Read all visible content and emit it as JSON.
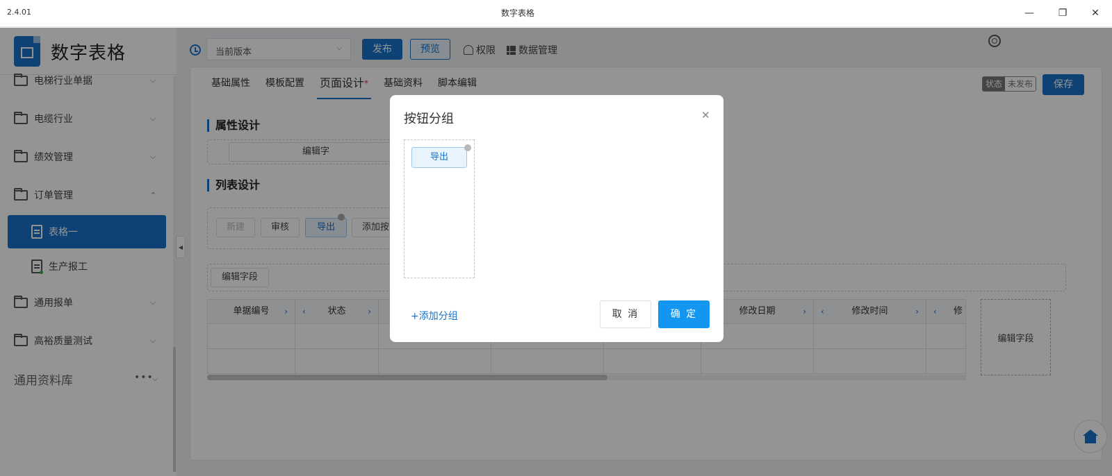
{
  "window": {
    "version": "2.4.01",
    "title": "数字表格",
    "controls": [
      "minimize-icon",
      "restore-icon",
      "close-icon"
    ]
  },
  "brand": {
    "name": "数字表格"
  },
  "sidebar": {
    "items": [
      {
        "label": "电梯行业单据",
        "icon": "folder-icon",
        "expanded": false
      },
      {
        "label": "电缆行业",
        "icon": "folder-icon",
        "expanded": false
      },
      {
        "label": "绩效管理",
        "icon": "folder-icon",
        "expanded": false
      },
      {
        "label": "订单管理",
        "icon": "folder-icon",
        "expanded": true
      }
    ],
    "sub_items": [
      {
        "label": "表格一",
        "icon": "document-icon",
        "active": true
      },
      {
        "label": "生产报工",
        "icon": "document-icon",
        "active": false
      }
    ],
    "items_after": [
      {
        "label": "通用报单",
        "icon": "folder-icon"
      },
      {
        "label": "高裕质量测试",
        "icon": "folder-icon"
      }
    ],
    "library": {
      "label": "通用资料库",
      "more": "•••"
    }
  },
  "toolbar": {
    "version_select": "当前版本",
    "publish": "发布",
    "preview": "预览",
    "permission": "权限",
    "data_manage": "数据管理"
  },
  "tabs": [
    {
      "label": "基础属性",
      "active": false
    },
    {
      "label": "模板配置",
      "active": false
    },
    {
      "label": "页面设计",
      "active": true,
      "modified": "*"
    },
    {
      "label": "基础资料",
      "active": false
    },
    {
      "label": "脚本编辑",
      "active": false
    }
  ],
  "status": {
    "label": "状态",
    "value": "未发布"
  },
  "save": "保存",
  "sections": {
    "attr": {
      "title": "属性设计",
      "field_button": "编辑字"
    },
    "list": {
      "title": "列表设计",
      "buttons": [
        {
          "label": "新建",
          "state": "disabled"
        },
        {
          "label": "审核",
          "state": "normal"
        },
        {
          "label": "导出",
          "state": "highlight"
        },
        {
          "label": "添加按",
          "state": "normal"
        }
      ],
      "edit_field": "编辑字段"
    }
  },
  "table": {
    "columns": [
      {
        "label": "单据编号",
        "left": false,
        "right": true
      },
      {
        "label": "状态",
        "left": true,
        "right": true
      },
      {
        "label": "",
        "left": false,
        "right": false
      },
      {
        "label": "",
        "left": false,
        "right": false
      },
      {
        "label": "",
        "left": false,
        "right": false
      },
      {
        "label": "修改日期",
        "left": false,
        "right": true
      },
      {
        "label": "修改时间",
        "left": true,
        "right": true
      },
      {
        "label": "修",
        "left": true,
        "right": false
      }
    ],
    "rows": 2,
    "edit_column": "编辑字段"
  },
  "modal": {
    "title": "按钮分组",
    "group_buttons": [
      "导出"
    ],
    "add_group": "+添加分组",
    "cancel": "取 消",
    "confirm": "确 定"
  },
  "colors": {
    "primary": "#1a73c9",
    "confirm": "#1296f0",
    "modified_star": "#e4393c"
  }
}
